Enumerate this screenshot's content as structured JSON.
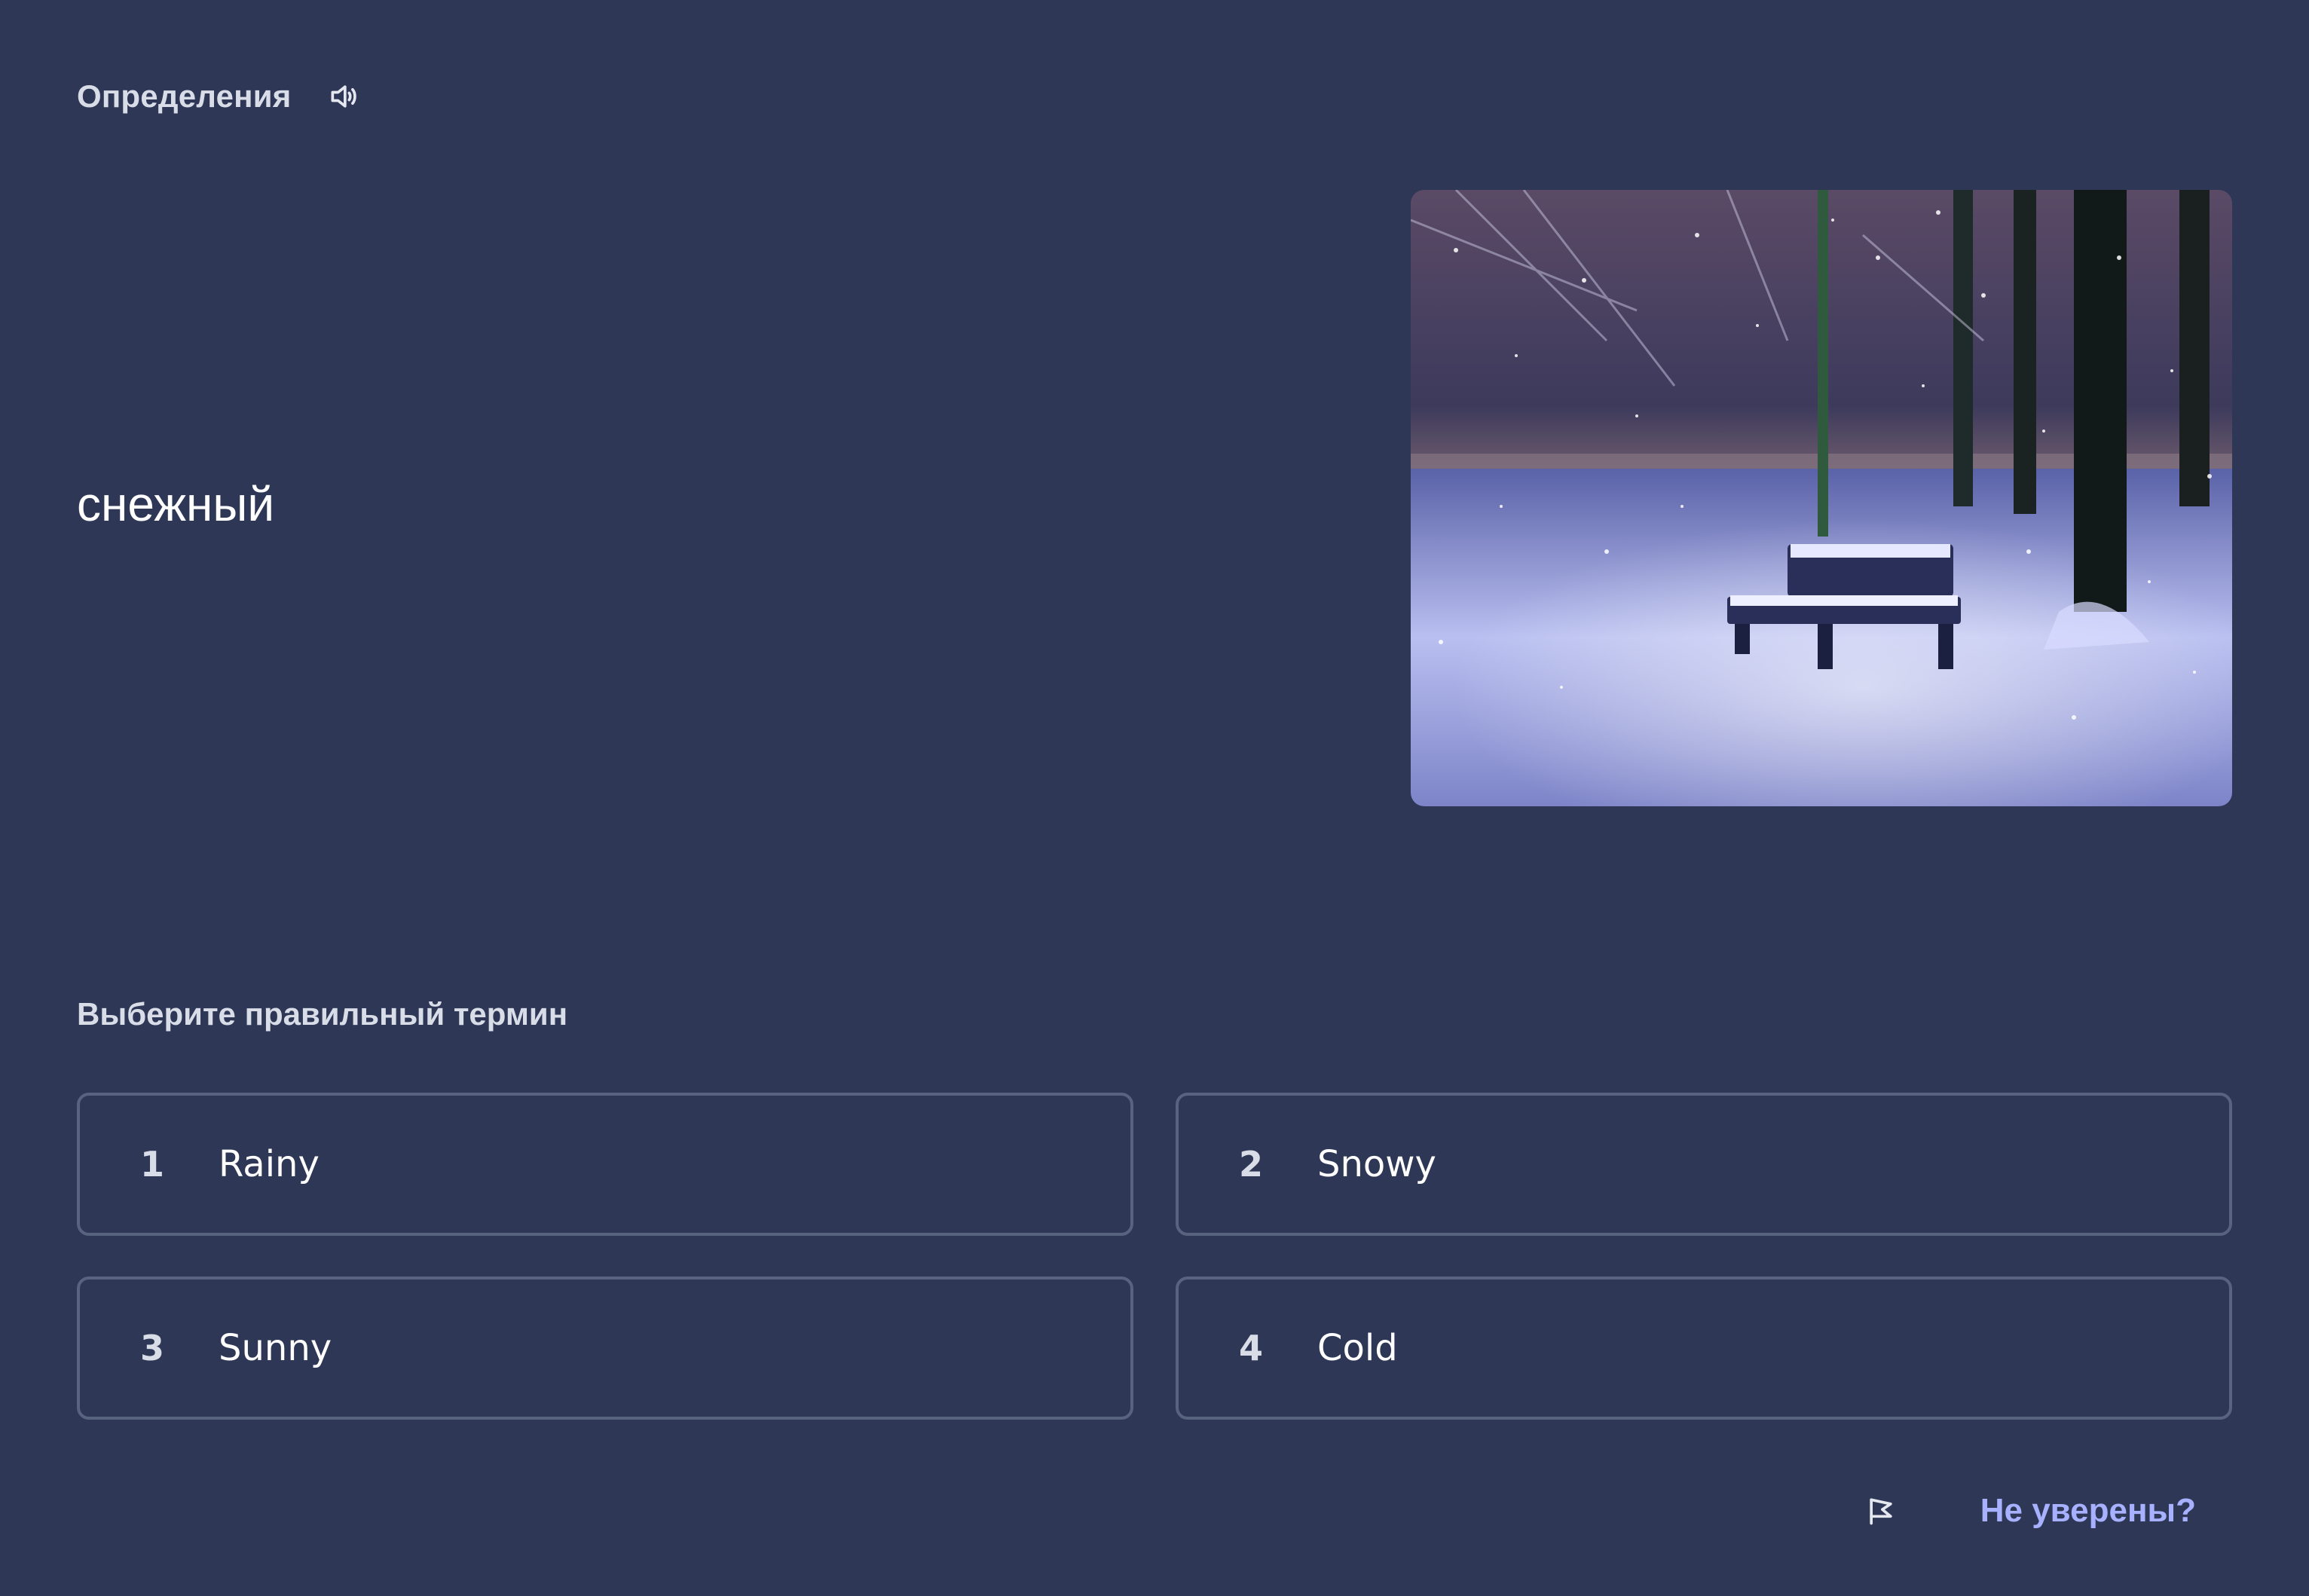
{
  "header": {
    "section_label": "Определения",
    "audio_icon": "speaker-icon"
  },
  "term": "снежный",
  "image": {
    "description_icon": "snowy-park-bench-photo"
  },
  "prompt": "Выберите правильный термин",
  "options": [
    {
      "number": "1",
      "label": "Rainy"
    },
    {
      "number": "2",
      "label": "Snowy"
    },
    {
      "number": "3",
      "label": "Sunny"
    },
    {
      "number": "4",
      "label": "Cold"
    }
  ],
  "footer": {
    "flag_icon": "flag-icon",
    "unsure_label": "Не уверены?"
  },
  "colors": {
    "background": "#2e3856",
    "option_border": "#586380",
    "link": "#a8b1ff"
  }
}
